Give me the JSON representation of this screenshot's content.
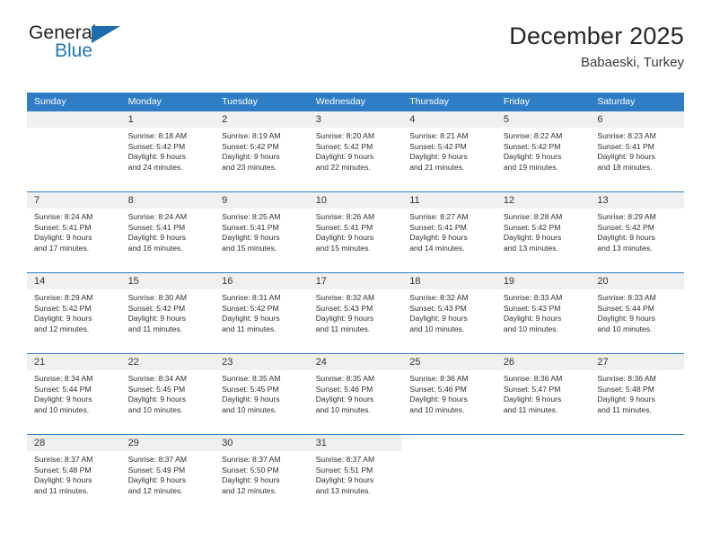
{
  "brand": {
    "line1": "General",
    "line2": "Blue",
    "triangle_color": "#1c6cb0"
  },
  "header": {
    "title": "December 2025",
    "subtitle": "Babaeski, Turkey"
  },
  "theme": {
    "header_blue": "#2f7dc4",
    "band_gray": "#f0f0f0",
    "text": "#303030"
  },
  "weekday_headers": [
    "Sunday",
    "Monday",
    "Tuesday",
    "Wednesday",
    "Thursday",
    "Friday",
    "Saturday"
  ],
  "weeks": [
    [
      {
        "day": "",
        "sunrise": "",
        "sunset": "",
        "daylight1": "",
        "daylight2": ""
      },
      {
        "day": "1",
        "sunrise": "Sunrise: 8:18 AM",
        "sunset": "Sunset: 5:42 PM",
        "daylight1": "Daylight: 9 hours",
        "daylight2": "and 24 minutes."
      },
      {
        "day": "2",
        "sunrise": "Sunrise: 8:19 AM",
        "sunset": "Sunset: 5:42 PM",
        "daylight1": "Daylight: 9 hours",
        "daylight2": "and 23 minutes."
      },
      {
        "day": "3",
        "sunrise": "Sunrise: 8:20 AM",
        "sunset": "Sunset: 5:42 PM",
        "daylight1": "Daylight: 9 hours",
        "daylight2": "and 22 minutes."
      },
      {
        "day": "4",
        "sunrise": "Sunrise: 8:21 AM",
        "sunset": "Sunset: 5:42 PM",
        "daylight1": "Daylight: 9 hours",
        "daylight2": "and 21 minutes."
      },
      {
        "day": "5",
        "sunrise": "Sunrise: 8:22 AM",
        "sunset": "Sunset: 5:42 PM",
        "daylight1": "Daylight: 9 hours",
        "daylight2": "and 19 minutes."
      },
      {
        "day": "6",
        "sunrise": "Sunrise: 8:23 AM",
        "sunset": "Sunset: 5:41 PM",
        "daylight1": "Daylight: 9 hours",
        "daylight2": "and 18 minutes."
      }
    ],
    [
      {
        "day": "7",
        "sunrise": "Sunrise: 8:24 AM",
        "sunset": "Sunset: 5:41 PM",
        "daylight1": "Daylight: 9 hours",
        "daylight2": "and 17 minutes."
      },
      {
        "day": "8",
        "sunrise": "Sunrise: 8:24 AM",
        "sunset": "Sunset: 5:41 PM",
        "daylight1": "Daylight: 9 hours",
        "daylight2": "and 16 minutes."
      },
      {
        "day": "9",
        "sunrise": "Sunrise: 8:25 AM",
        "sunset": "Sunset: 5:41 PM",
        "daylight1": "Daylight: 9 hours",
        "daylight2": "and 15 minutes."
      },
      {
        "day": "10",
        "sunrise": "Sunrise: 8:26 AM",
        "sunset": "Sunset: 5:41 PM",
        "daylight1": "Daylight: 9 hours",
        "daylight2": "and 15 minutes."
      },
      {
        "day": "11",
        "sunrise": "Sunrise: 8:27 AM",
        "sunset": "Sunset: 5:41 PM",
        "daylight1": "Daylight: 9 hours",
        "daylight2": "and 14 minutes."
      },
      {
        "day": "12",
        "sunrise": "Sunrise: 8:28 AM",
        "sunset": "Sunset: 5:42 PM",
        "daylight1": "Daylight: 9 hours",
        "daylight2": "and 13 minutes."
      },
      {
        "day": "13",
        "sunrise": "Sunrise: 8:29 AM",
        "sunset": "Sunset: 5:42 PM",
        "daylight1": "Daylight: 9 hours",
        "daylight2": "and 13 minutes."
      }
    ],
    [
      {
        "day": "14",
        "sunrise": "Sunrise: 8:29 AM",
        "sunset": "Sunset: 5:42 PM",
        "daylight1": "Daylight: 9 hours",
        "daylight2": "and 12 minutes."
      },
      {
        "day": "15",
        "sunrise": "Sunrise: 8:30 AM",
        "sunset": "Sunset: 5:42 PM",
        "daylight1": "Daylight: 9 hours",
        "daylight2": "and 11 minutes."
      },
      {
        "day": "16",
        "sunrise": "Sunrise: 8:31 AM",
        "sunset": "Sunset: 5:42 PM",
        "daylight1": "Daylight: 9 hours",
        "daylight2": "and 11 minutes."
      },
      {
        "day": "17",
        "sunrise": "Sunrise: 8:32 AM",
        "sunset": "Sunset: 5:43 PM",
        "daylight1": "Daylight: 9 hours",
        "daylight2": "and 11 minutes."
      },
      {
        "day": "18",
        "sunrise": "Sunrise: 8:32 AM",
        "sunset": "Sunset: 5:43 PM",
        "daylight1": "Daylight: 9 hours",
        "daylight2": "and 10 minutes."
      },
      {
        "day": "19",
        "sunrise": "Sunrise: 8:33 AM",
        "sunset": "Sunset: 5:43 PM",
        "daylight1": "Daylight: 9 hours",
        "daylight2": "and 10 minutes."
      },
      {
        "day": "20",
        "sunrise": "Sunrise: 8:33 AM",
        "sunset": "Sunset: 5:44 PM",
        "daylight1": "Daylight: 9 hours",
        "daylight2": "and 10 minutes."
      }
    ],
    [
      {
        "day": "21",
        "sunrise": "Sunrise: 8:34 AM",
        "sunset": "Sunset: 5:44 PM",
        "daylight1": "Daylight: 9 hours",
        "daylight2": "and 10 minutes."
      },
      {
        "day": "22",
        "sunrise": "Sunrise: 8:34 AM",
        "sunset": "Sunset: 5:45 PM",
        "daylight1": "Daylight: 9 hours",
        "daylight2": "and 10 minutes."
      },
      {
        "day": "23",
        "sunrise": "Sunrise: 8:35 AM",
        "sunset": "Sunset: 5:45 PM",
        "daylight1": "Daylight: 9 hours",
        "daylight2": "and 10 minutes."
      },
      {
        "day": "24",
        "sunrise": "Sunrise: 8:35 AM",
        "sunset": "Sunset: 5:46 PM",
        "daylight1": "Daylight: 9 hours",
        "daylight2": "and 10 minutes."
      },
      {
        "day": "25",
        "sunrise": "Sunrise: 8:36 AM",
        "sunset": "Sunset: 5:46 PM",
        "daylight1": "Daylight: 9 hours",
        "daylight2": "and 10 minutes."
      },
      {
        "day": "26",
        "sunrise": "Sunrise: 8:36 AM",
        "sunset": "Sunset: 5:47 PM",
        "daylight1": "Daylight: 9 hours",
        "daylight2": "and 11 minutes."
      },
      {
        "day": "27",
        "sunrise": "Sunrise: 8:36 AM",
        "sunset": "Sunset: 5:48 PM",
        "daylight1": "Daylight: 9 hours",
        "daylight2": "and 11 minutes."
      }
    ],
    [
      {
        "day": "28",
        "sunrise": "Sunrise: 8:37 AM",
        "sunset": "Sunset: 5:48 PM",
        "daylight1": "Daylight: 9 hours",
        "daylight2": "and 11 minutes."
      },
      {
        "day": "29",
        "sunrise": "Sunrise: 8:37 AM",
        "sunset": "Sunset: 5:49 PM",
        "daylight1": "Daylight: 9 hours",
        "daylight2": "and 12 minutes."
      },
      {
        "day": "30",
        "sunrise": "Sunrise: 8:37 AM",
        "sunset": "Sunset: 5:50 PM",
        "daylight1": "Daylight: 9 hours",
        "daylight2": "and 12 minutes."
      },
      {
        "day": "31",
        "sunrise": "Sunrise: 8:37 AM",
        "sunset": "Sunset: 5:51 PM",
        "daylight1": "Daylight: 9 hours",
        "daylight2": "and 13 minutes."
      },
      {
        "day": "",
        "sunrise": "",
        "sunset": "",
        "daylight1": "",
        "daylight2": ""
      },
      {
        "day": "",
        "sunrise": "",
        "sunset": "",
        "daylight1": "",
        "daylight2": ""
      },
      {
        "day": "",
        "sunrise": "",
        "sunset": "",
        "daylight1": "",
        "daylight2": ""
      }
    ]
  ]
}
